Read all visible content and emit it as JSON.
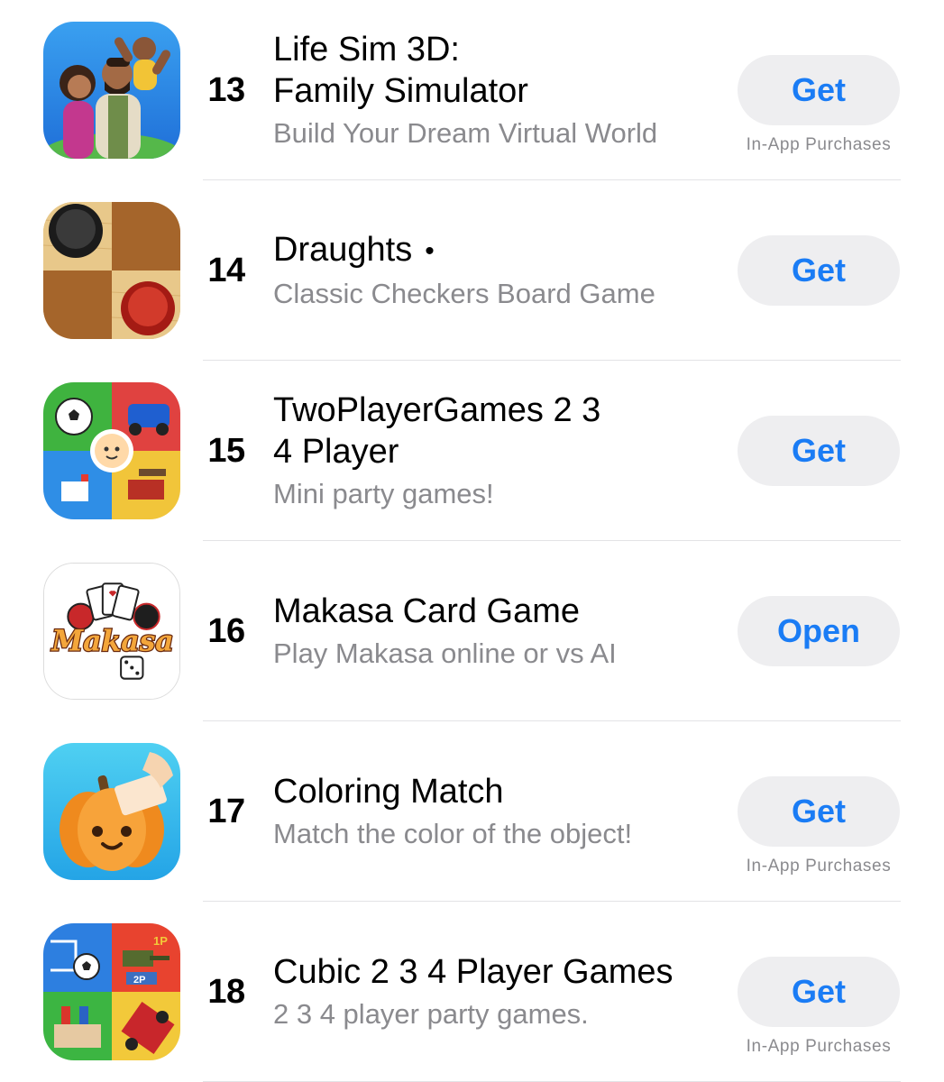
{
  "apps": [
    {
      "rank": "13",
      "title": "Life Sim 3D:\nFamily Simulator",
      "subtitle": "Build Your Dream Virtual World",
      "button": "Get",
      "iap": "In-App Purchases",
      "icon": "family-characters-app-icon"
    },
    {
      "rank": "14",
      "title": "Draughts",
      "dot": "•",
      "subtitle": "Classic Checkers Board Game",
      "button": "Get",
      "iap": "",
      "icon": "checkers-board-app-icon"
    },
    {
      "rank": "15",
      "title": "TwoPlayerGames 2 3\n4 Player",
      "subtitle": "Mini party games!",
      "button": "Get",
      "iap": "",
      "icon": "four-minigames-app-icon"
    },
    {
      "rank": "16",
      "title": "Makasa Card Game",
      "subtitle": "Play Makasa online or vs AI",
      "button": "Open",
      "iap": "",
      "icon": "makasa-cards-logo-app-icon"
    },
    {
      "rank": "17",
      "title": "Coloring Match",
      "subtitle": "Match the color of the object!",
      "button": "Get",
      "iap": "In-App Purchases",
      "icon": "pumpkin-app-icon"
    },
    {
      "rank": "18",
      "title": "Cubic 2 3 4 Player Games",
      "subtitle": "2 3 4 player party games.",
      "button": "Get",
      "iap": "In-App Purchases",
      "icon": "cubic-minigames-app-icon"
    }
  ],
  "colors": {
    "accent": "#1a7cf5",
    "button_bg": "#eeeef0",
    "subtitle": "#8a8a8e",
    "separator": "#e3e3e6"
  },
  "icon_text": {
    "makasa_logo": "Makasa",
    "cubic_tag_1": "1P",
    "cubic_tag_2": "2P"
  }
}
